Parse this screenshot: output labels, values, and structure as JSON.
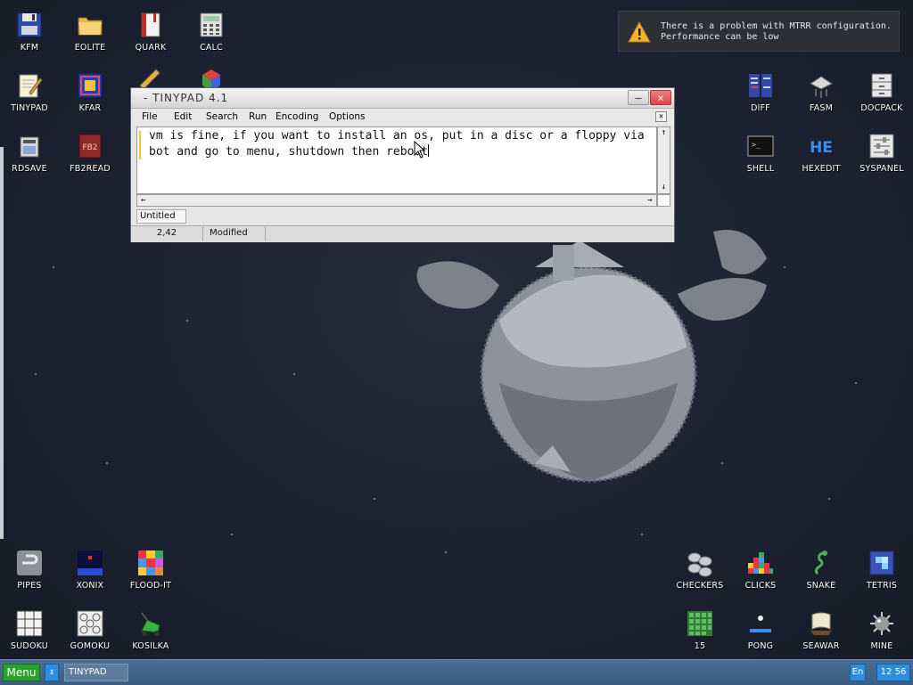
{
  "desktop": {
    "icons_left": [
      {
        "label": "KFM",
        "icon": "floppy-disk-icon"
      },
      {
        "label": "EOLITE",
        "icon": "folder-icon"
      },
      {
        "label": "QUARK",
        "icon": "notebook-icon"
      },
      {
        "label": "CALC",
        "icon": "calculator-icon"
      },
      {
        "label": "TINYPAD",
        "icon": "notepad-pencil-icon"
      },
      {
        "label": "KFAR",
        "icon": "archive-icon"
      },
      {
        "label": "RDSAVE",
        "icon": "ramdisk-save-icon"
      },
      {
        "label": "FB2READ",
        "icon": "book-reader-icon"
      }
    ],
    "icons_right": [
      {
        "label": "DIFF",
        "icon": "diff-icon"
      },
      {
        "label": "FASM",
        "icon": "assembler-icon"
      },
      {
        "label": "DOCPACK",
        "icon": "cabinet-icon"
      },
      {
        "label": "SHELL",
        "icon": "terminal-icon"
      },
      {
        "label": "HEXEDIT",
        "icon": "hex-editor-icon"
      },
      {
        "label": "SYSPANEL",
        "icon": "sliders-panel-icon"
      }
    ],
    "icons_games_left": [
      {
        "label": "PIPES",
        "icon": "pipes-icon"
      },
      {
        "label": "XONIX",
        "icon": "xonix-icon"
      },
      {
        "label": "FLOOD-IT",
        "icon": "flood-it-icon"
      },
      {
        "label": "SUDOKU",
        "icon": "sudoku-icon"
      },
      {
        "label": "GOMOKU",
        "icon": "gomoku-icon"
      },
      {
        "label": "KOSILKA",
        "icon": "lawnmower-icon"
      }
    ],
    "icons_games_right": [
      {
        "label": "CHECKERS",
        "icon": "checkers-icon"
      },
      {
        "label": "CLICKS",
        "icon": "clicks-icon"
      },
      {
        "label": "SNAKE",
        "icon": "snake-icon"
      },
      {
        "label": "TETRIS",
        "icon": "tetris-icon"
      },
      {
        "label": "15",
        "icon": "fifteen-puzzle-icon"
      },
      {
        "label": "PONG",
        "icon": "pong-icon"
      },
      {
        "label": "SEAWAR",
        "icon": "sailboat-icon"
      },
      {
        "label": "MINE",
        "icon": "mine-icon"
      }
    ]
  },
  "notification": {
    "line1": "There is a problem with MTRR configuration.",
    "line2": "Performance can be low",
    "icon": "warning-icon"
  },
  "window": {
    "title": "- TINYPAD 4.1",
    "menu": [
      "File",
      "Edit",
      "Search",
      "Run",
      "Encoding",
      "Options"
    ],
    "text_lines": [
      "vm is fine, if you want to install an os, put in a disc or a floppy via",
      "bot and go to menu, shutdown then reboot"
    ],
    "tab": "Untitled",
    "status": {
      "position": "2,42",
      "state": "Modified"
    }
  },
  "taskbar": {
    "menu_label": "Menu",
    "switch_label": "↕",
    "task_label": "TINYPAD",
    "lang": "En",
    "clock": "12 56"
  },
  "colors": {
    "desktop": "#1b2130",
    "taskbar": "#3f6388",
    "accent_green": "#2aa12a",
    "accent_blue": "#2d8ee0",
    "close_red": "#d94848"
  }
}
